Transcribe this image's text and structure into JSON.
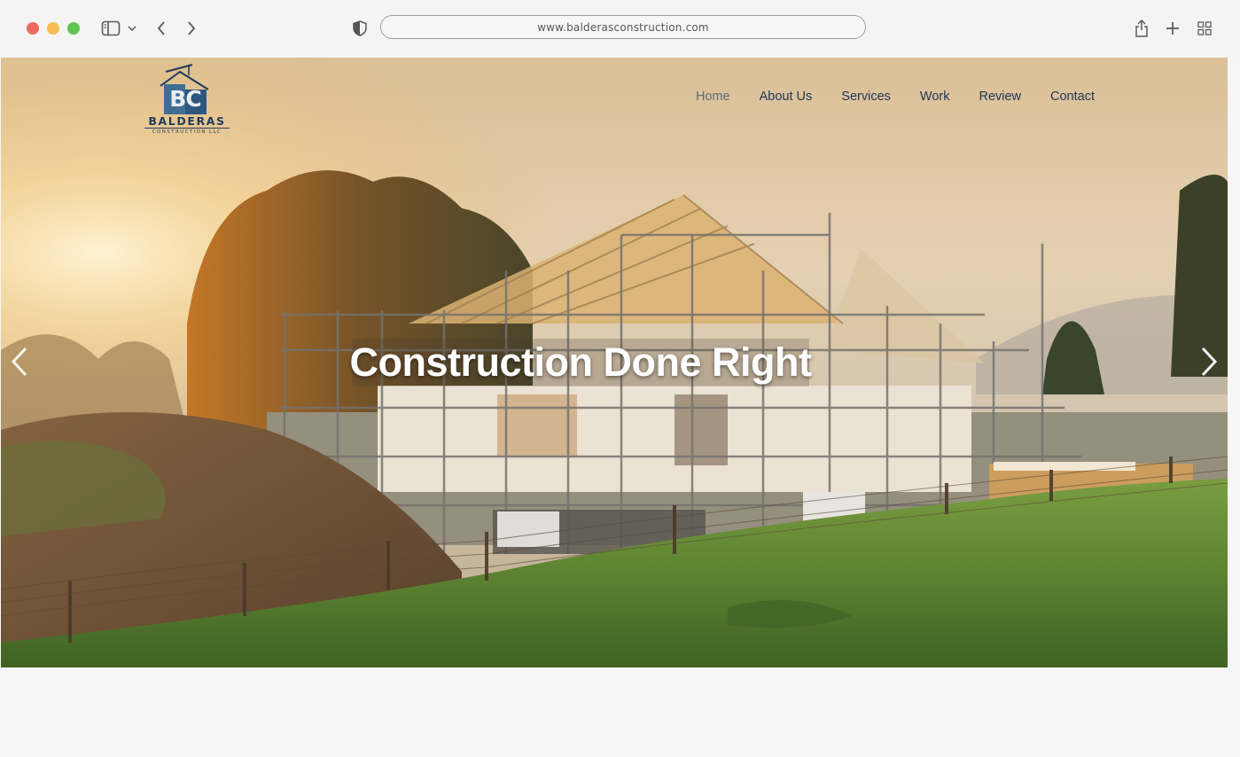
{
  "browser": {
    "url": "www.balderasconstruction.com"
  },
  "site": {
    "logo": {
      "name": "BALDERAS",
      "sub": "CONSTRUCTION LLC",
      "monogram": "BC"
    },
    "nav": [
      {
        "label": "Home",
        "active": true
      },
      {
        "label": "About Us",
        "active": false
      },
      {
        "label": "Services",
        "active": false
      },
      {
        "label": "Work",
        "active": false
      },
      {
        "label": "Review",
        "active": false
      },
      {
        "label": "Contact",
        "active": false
      }
    ],
    "hero": {
      "headline": "Construction Done Right"
    }
  },
  "colors": {
    "brand_navy": "#1f3b5a",
    "nav_text": "#1f3554",
    "nav_active": "#5f6b78"
  },
  "icons": {
    "sidebar": "sidebar-icon",
    "back": "chevron-left-icon",
    "forward": "chevron-right-icon",
    "shield": "shield-icon",
    "share": "share-icon",
    "new_tab": "plus-icon",
    "tabs": "grid-icon",
    "slider_prev": "chevron-left-icon",
    "slider_next": "chevron-right-icon"
  }
}
